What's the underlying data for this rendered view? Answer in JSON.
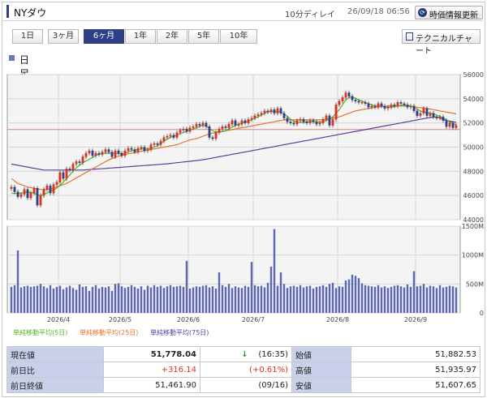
{
  "header": {
    "title": "NYダウ",
    "delay": "10分ディレイ",
    "timestamp": "26/09/18 06:56",
    "refresh_label": "時価情報更新"
  },
  "tabs": [
    {
      "label": "1日",
      "selected": false
    },
    {
      "label": "3ヶ月",
      "selected": false
    },
    {
      "label": "6ヶ月",
      "selected": true
    },
    {
      "label": "1年",
      "selected": false
    },
    {
      "label": "2年",
      "selected": false
    },
    {
      "label": "5年",
      "selected": false
    },
    {
      "label": "10年",
      "selected": false
    }
  ],
  "technical_label": "テクニカルチャート",
  "section_label": "日足",
  "colors": {
    "accent": "#2e3f86",
    "up": "#e0301e",
    "down": "#2e3f86",
    "ma5": "#55b52a",
    "ma25": "#e8732a",
    "ma75": "#5a3fa0",
    "volume": "#5c67b4"
  },
  "chart_data": {
    "type": "candlestick",
    "price_axis": {
      "ticks": [
        44000,
        46000,
        48000,
        50000,
        52000,
        54000,
        56000
      ],
      "tick_labels": [
        "44000",
        "46000",
        "48000",
        "50000",
        "52000",
        "54000",
        "56000"
      ],
      "range": [
        44000,
        56000
      ]
    },
    "volume_axis": {
      "ticks": [
        0,
        500,
        1000,
        1500
      ],
      "tick_labels": [
        "0",
        "500M",
        "1000M",
        "1500M"
      ],
      "range": [
        0,
        1500
      ]
    },
    "x_labels": [
      "2026/4",
      "2026/5",
      "2026/6",
      "2026/7",
      "2026/8",
      "2026/9"
    ],
    "reference_line": 51461.9,
    "legend": [
      {
        "label": "単純移動平均(5日)",
        "color": "#55b52a"
      },
      {
        "label": "単純移動平均(25日)",
        "color": "#e8732a"
      },
      {
        "label": "単純移動平均(75日)",
        "color": "#5a3fa0"
      }
    ],
    "close": [
      46700,
      46300,
      45900,
      46100,
      46500,
      45800,
      46200,
      46600,
      45200,
      46000,
      46500,
      46800,
      46200,
      46900,
      47100,
      47900,
      47400,
      48200,
      48100,
      48600,
      48800,
      48700,
      49200,
      49500,
      49700,
      49300,
      49500,
      49400,
      49600,
      49800,
      49600,
      49200,
      49700,
      49500,
      49300,
      49700,
      49900,
      49800,
      49600,
      49900,
      50000,
      49700,
      49800,
      50200,
      50300,
      50200,
      50500,
      50800,
      50900,
      51000,
      50800,
      51200,
      51400,
      51500,
      51300,
      51600,
      51700,
      51900,
      51800,
      52000,
      51700,
      50800,
      50700,
      51200,
      51500,
      51700,
      51600,
      51900,
      52200,
      51800,
      51900,
      52200,
      52000,
      52300,
      52400,
      52600,
      52700,
      52800,
      53000,
      52900,
      53100,
      52800,
      53200,
      52800,
      52400,
      52100,
      52000,
      51900,
      52200,
      52300,
      52100,
      52000,
      52200,
      52100,
      51900,
      52000,
      52300,
      52600,
      51800,
      52300,
      53500,
      53800,
      54100,
      54500,
      54200,
      53900,
      53800,
      53700,
      53700,
      53600,
      53300,
      53400,
      53300,
      53600,
      53400,
      53200,
      53300,
      53500,
      53400,
      53700,
      53600,
      53500,
      53300,
      53400,
      53000,
      52600,
      52800,
      53200,
      52600,
      52800,
      52500,
      52400,
      52500,
      52200,
      51700,
      52000,
      51600,
      51800
    ],
    "volume": [
      450,
      480,
      1080,
      440,
      460,
      470,
      450,
      460,
      470,
      500,
      460,
      430,
      480,
      420,
      450,
      470,
      410,
      440,
      470,
      430,
      400,
      490,
      450,
      460,
      380,
      450,
      480,
      420,
      450,
      440,
      460,
      380,
      500,
      510,
      460,
      430,
      450,
      480,
      450,
      420,
      460,
      400,
      470,
      440,
      480,
      450,
      470,
      430,
      460,
      480,
      450,
      460,
      470,
      450,
      900,
      420,
      440,
      460,
      450,
      470,
      480,
      440,
      460,
      420,
      700,
      480,
      450,
      500,
      430,
      460,
      440,
      430,
      470,
      450,
      880,
      480,
      460,
      470,
      440,
      520,
      800,
      1450,
      470,
      700,
      500,
      430,
      460,
      470,
      450,
      480,
      440,
      460,
      470,
      420,
      450,
      460,
      480,
      450,
      500,
      520,
      430,
      460,
      450,
      560,
      580,
      660,
      640,
      600,
      510,
      480,
      470,
      460,
      450,
      480,
      440,
      460,
      430,
      450,
      470,
      480,
      460,
      440,
      490,
      450,
      720,
      460,
      470,
      500,
      440,
      470,
      460,
      430,
      480,
      440,
      450,
      470,
      460,
      440
    ],
    "ma5_points": [
      46200,
      46150,
      46180,
      46200,
      46250,
      46300,
      46250,
      46200,
      46050,
      46000,
      46100,
      46200,
      46350,
      46450,
      46600,
      46850,
      47100,
      47400,
      47700,
      48000,
      48300,
      48500,
      48700,
      48850,
      49000,
      49150,
      49300,
      49400,
      49450,
      49500,
      49500,
      49500,
      49500,
      49450,
      49450,
      49500,
      49600,
      49700,
      49750,
      49800,
      49850,
      49850,
      49850,
      49900,
      50000,
      50100,
      50300,
      50500,
      50650,
      50800,
      50900,
      51000,
      51100,
      51200,
      51300,
      51400,
      51500,
      51600,
      51700,
      51800,
      51750,
      51550,
      51350,
      51250,
      51250,
      51300,
      51350,
      51500,
      51650,
      51800,
      51900,
      52000,
      52050,
      52150,
      52250,
      52400,
      52500,
      52650,
      52800,
      52900,
      52950,
      52950,
      52950,
      52900,
      52750,
      52550,
      52300,
      52150,
      52050,
      52050,
      52050,
      52100,
      52100,
      52100,
      52100,
      52050,
      52100,
      52200,
      52300,
      52500,
      52800,
      53100,
      53500,
      53900,
      54100,
      54150,
      54050,
      53900,
      53800,
      53700,
      53600,
      53500,
      53400,
      53400,
      53400,
      53350,
      53300,
      53300,
      53350,
      53400,
      53450,
      53500,
      53450,
      53400,
      53300,
      53150,
      53000,
      52900,
      52850,
      52800,
      52750,
      52650,
      52550,
      52400,
      52250,
      52100,
      51950,
      51850
    ],
    "ma25_points": [
      47400,
      47200,
      47000,
      46900,
      46800,
      46700,
      46650,
      46600,
      46550,
      46500,
      46500,
      46500,
      46550,
      46600,
      46700,
      46800,
      46900,
      47000,
      47150,
      47300,
      47450,
      47600,
      47750,
      47900,
      48050,
      48200,
      48350,
      48500,
      48650,
      48800,
      48950,
      49050,
      49150,
      49250,
      49300,
      49400,
      49450,
      49500,
      49550,
      49600,
      49650,
      49700,
      49750,
      49800,
      49850,
      49900,
      49950,
      50000,
      50050,
      50100,
      50150,
      50200,
      50300,
      50400,
      50500,
      50600,
      50650,
      50700,
      50800,
      50900,
      51000,
      51100,
      51150,
      51200,
      51250,
      51300,
      51350,
      51400,
      51450,
      51500,
      51550,
      51600,
      51650,
      51700,
      51750,
      51800,
      51850,
      51900,
      51950,
      52000,
      52050,
      52100,
      52150,
      52200,
      52250,
      52250,
      52250,
      52250,
      52250,
      52250,
      52250,
      52250,
      52250,
      52250,
      52250,
      52250,
      52250,
      52300,
      52350,
      52400,
      52450,
      52500,
      52600,
      52700,
      52800,
      52900,
      53000,
      53050,
      53100,
      53150,
      53200,
      53250,
      53300,
      53300,
      53350,
      53350,
      53400,
      53400,
      53400,
      53400,
      53400,
      53400,
      53400,
      53400,
      53350,
      53300,
      53250,
      53250,
      53200,
      53150,
      53100,
      53050,
      53000,
      52950,
      52900,
      52850,
      52800,
      52750
    ],
    "ma75_points": [
      48600,
      48550,
      48500,
      48450,
      48400,
      48350,
      48300,
      48250,
      48200,
      48150,
      48100,
      48100,
      48100,
      48100,
      48100,
      48100,
      48100,
      48100,
      48100,
      48100,
      48100,
      48100,
      48100,
      48120,
      48140,
      48160,
      48180,
      48200,
      48220,
      48240,
      48260,
      48280,
      48300,
      48320,
      48340,
      48360,
      48380,
      48400,
      48420,
      48440,
      48460,
      48480,
      48500,
      48520,
      48540,
      48560,
      48580,
      48600,
      48620,
      48650,
      48680,
      48710,
      48740,
      48770,
      48800,
      48830,
      48860,
      48890,
      48920,
      48960,
      49000,
      49050,
      49100,
      49150,
      49200,
      49250,
      49300,
      49350,
      49400,
      49450,
      49500,
      49550,
      49600,
      49650,
      49700,
      49750,
      49800,
      49850,
      49900,
      49950,
      50000,
      50050,
      50100,
      50150,
      50200,
      50250,
      50300,
      50350,
      50400,
      50450,
      50500,
      50550,
      50600,
      50650,
      50700,
      50750,
      50800,
      50850,
      50900,
      50950,
      51000,
      51050,
      51100,
      51150,
      51200,
      51250,
      51300,
      51350,
      51400,
      51450,
      51500,
      51550,
      51600,
      51650,
      51700,
      51750,
      51800,
      51850,
      51900,
      51950,
      52000,
      52050,
      52100,
      52150,
      52200,
      52250,
      52300,
      52350,
      52400,
      52450,
      52480,
      52500,
      52400,
      52300,
      52200,
      52150,
      52100,
      52050
    ]
  },
  "stats": {
    "current_label": "現在値",
    "current_value": "51,778.04",
    "current_arrow": "↓",
    "current_time": "(16:35)",
    "change_label": "前日比",
    "change_value": "+316.14",
    "change_pct": "(+0.61%)",
    "prev_close_label": "前日終値",
    "prev_close_value": "51,461.90",
    "prev_close_date": "(09/16)",
    "open_label": "始値",
    "open_value": "51,882.53",
    "high_label": "高値",
    "high_value": "51,935.97",
    "low_label": "安値",
    "low_value": "51,607.65"
  }
}
